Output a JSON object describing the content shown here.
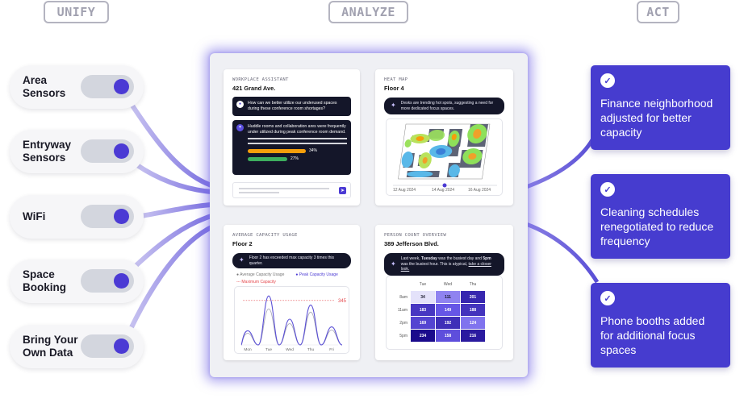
{
  "columns": {
    "unify": "UNIFY",
    "analyze": "ANALYZE",
    "act": "ACT"
  },
  "sources": [
    {
      "label": "Area Sensors",
      "enabled": true
    },
    {
      "label": "Entryway Sensors",
      "enabled": true
    },
    {
      "label": "WiFi",
      "enabled": true
    },
    {
      "label": "Space Booking",
      "enabled": true
    },
    {
      "label": "Bring Your Own Data",
      "enabled": true
    }
  ],
  "cards": {
    "assistant": {
      "eyebrow": "WORKPLACE ASSISTANT",
      "title": "421 Grand Ave.",
      "question": "How can we better utilize our underused spaces during these conference room shortages?",
      "answer": "Huddle rooms and collaboration ares were frequently under utilized during peak conference room demand.",
      "bars": [
        {
          "label": "34%",
          "value": 34,
          "color": "#f59e0b"
        },
        {
          "label": "27%",
          "value": 27,
          "color": "#3dae5e"
        }
      ],
      "send_icon": "send-icon"
    },
    "heatmap": {
      "eyebrow": "HEAT MAP",
      "title": "Floor 4",
      "insight": "Desks are trending hot spots, suggesting a need for more dedicated focus spaces.",
      "dates": [
        "12 Aug 2024",
        "14 Aug 2024",
        "16 Aug 2024"
      ],
      "selected_date": "14 Aug 2024"
    },
    "capacity": {
      "eyebrow": "AVERAGE CAPACITY USAGE",
      "title": "Floor 2",
      "insight": "Floor 2 has exceeded max capacity 3 times this quarter.",
      "legend": {
        "average": "Average Capacity Usage",
        "peak": "Peak Capacity Usage",
        "max": "Maximum Capacity"
      },
      "max_value_label": "345",
      "days": [
        "Mon",
        "Tue",
        "Wed",
        "Thu",
        "Fri"
      ]
    },
    "person_count": {
      "eyebrow": "PERSON COUNT OVERVIEW",
      "title": "389 Jefferson Blvd.",
      "insight_parts": {
        "pre": "Last week, ",
        "day": "Tuesday",
        "mid": " was the busiest day and ",
        "hour": "5pm",
        "post": " was the busiest hour. This is atypical, ",
        "link": "take a closer look."
      },
      "columns": [
        "Tue",
        "Wed",
        "Thu"
      ],
      "rows": [
        "8am",
        "11am",
        "2pm",
        "5pm"
      ],
      "values": [
        [
          34,
          111,
          201
        ],
        [
          183,
          149,
          188
        ],
        [
          169,
          192,
          124
        ],
        [
          234,
          158,
          216
        ]
      ]
    }
  },
  "chart_data": [
    {
      "type": "line",
      "title": "Floor 2 — Average Capacity Usage",
      "categories": [
        "Mon",
        "Tue",
        "Wed",
        "Thu",
        "Fri"
      ],
      "series": [
        {
          "name": "Peak Capacity Usage",
          "values": [
            110,
            380,
            200,
            310,
            140
          ],
          "color": "#5a4fd6"
        },
        {
          "name": "Average Capacity Usage",
          "values": [
            90,
            280,
            165,
            255,
            115
          ],
          "color": "#a9a9b8"
        }
      ],
      "reference_lines": [
        {
          "name": "Maximum Capacity",
          "value": 345,
          "color": "#e5484d"
        }
      ],
      "ylim": [
        0,
        400
      ],
      "xlabel": "",
      "ylabel": ""
    },
    {
      "type": "heatmap",
      "title": "Person Count Overview — 389 Jefferson Blvd.",
      "x": [
        "Tue",
        "Wed",
        "Thu"
      ],
      "y": [
        "8am",
        "11am",
        "2pm",
        "5pm"
      ],
      "values": [
        [
          34,
          111,
          201
        ],
        [
          183,
          149,
          188
        ],
        [
          169,
          192,
          124
        ],
        [
          234,
          158,
          216
        ]
      ]
    }
  ],
  "actions": [
    {
      "text": "Finance neighborhood adjusted for better capacity",
      "icon": "check-icon"
    },
    {
      "text": "Cleaning schedules renegotiated to reduce frequency",
      "icon": "check-icon"
    },
    {
      "text": "Phone booths added for additional focus spaces",
      "icon": "check-icon"
    }
  ],
  "colors": {
    "accent": "#463ccf",
    "toggle_on": "#4b3ad4",
    "connector": "#8b80e0",
    "panel_glow": "#7669e6",
    "dark": "#141629"
  }
}
